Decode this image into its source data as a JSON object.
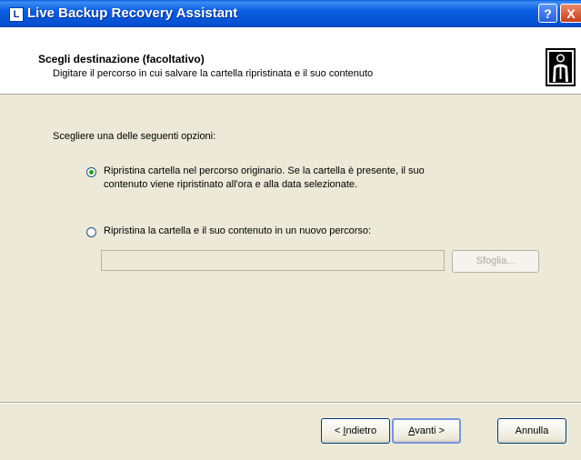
{
  "window": {
    "title": "Live Backup Recovery Assistant",
    "app_icon_letter": "L",
    "help_label": "?",
    "close_label": "X"
  },
  "header": {
    "title": "Scegli destinazione (facoltativo)",
    "subtitle": "Digitare il percorso in cui salvare la cartella ripristinata e il suo contenuto",
    "icon": "person-figure-icon"
  },
  "content": {
    "prompt": "Scegliere una delle seguenti opzioni:",
    "options": [
      {
        "line1": "Ripristina cartella nel percorso originario. Se la cartella è presente, il suo",
        "line2": "contenuto viene ripristinato all'ora e alla data selezionate.",
        "selected": true
      },
      {
        "line1": "Ripristina la cartella e il suo contenuto in un nuovo percorso:",
        "line2": "",
        "selected": false
      }
    ],
    "path_value": "",
    "browse_label": "Sfoglia..."
  },
  "footer": {
    "back_prefix": "< ",
    "back_mnemonic": "I",
    "back_rest": "ndietro",
    "next_mnemonic": "A",
    "next_rest": "vanti >",
    "cancel_label": "Annulla"
  },
  "colors": {
    "titlebar": "#0a5ee0",
    "dialog_bg": "#ece9d8",
    "radio_dot": "#21a121"
  }
}
